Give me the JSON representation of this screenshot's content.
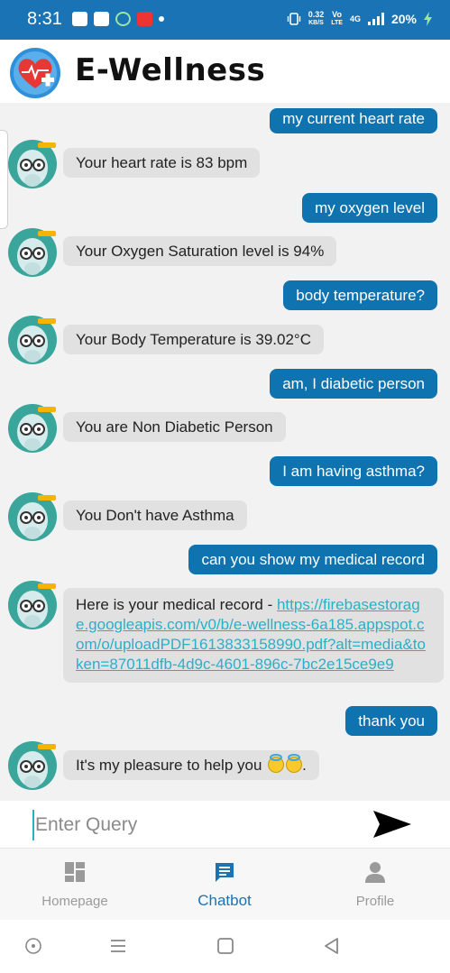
{
  "status_bar": {
    "time": "8:31",
    "net_speed_value": "0.32",
    "net_speed_unit": "KB/S",
    "volte_top": "Vo",
    "volte_bottom": "LTE",
    "network_type": "4G",
    "battery": "20%",
    "colors": {
      "background": "#1a73b4"
    }
  },
  "header": {
    "app_title": "E-Wellness",
    "logo_icon": "heart-plus-logo"
  },
  "chat": {
    "messages": [
      {
        "from": "user",
        "text": "my current heart rate"
      },
      {
        "from": "bot",
        "text": "Your heart rate is 83 bpm"
      },
      {
        "from": "user",
        "text": "my oxygen level"
      },
      {
        "from": "bot",
        "text": "Your Oxygen Saturation level is 94%"
      },
      {
        "from": "user",
        "text": "body temperature?"
      },
      {
        "from": "bot",
        "text": "Your Body Temperature is 39.02°C"
      },
      {
        "from": "user",
        "text": "am, I diabetic person"
      },
      {
        "from": "bot",
        "text": "You are Non Diabetic Person"
      },
      {
        "from": "user",
        "text": "I am having asthma?"
      },
      {
        "from": "bot",
        "text": "You Don't have Asthma"
      },
      {
        "from": "user",
        "text": "can you show my medical record"
      },
      {
        "from": "bot",
        "text": "Here is your medical record - ",
        "link": "https://firebasestorage.googleapis.com/v0/b/e-wellness-6a185.appspot.com/o/uploadPDF1613833158990.pdf?alt=media&token=87011dfb-4d9c-4601-896c-7bc2e15ce9e9"
      },
      {
        "from": "user",
        "text": "thank you"
      },
      {
        "from": "bot",
        "text": "It's my pleasure to help you",
        "suffix": "."
      }
    ],
    "colors": {
      "user_bubble": "#0f73b0",
      "bot_bubble": "#e1e1e1",
      "link": "#27b1c9"
    }
  },
  "input": {
    "placeholder": "Enter Query",
    "value": ""
  },
  "bottom_nav": {
    "items": [
      {
        "label": "Homepage",
        "icon": "dashboard-icon",
        "active": false
      },
      {
        "label": "Chatbot",
        "icon": "chat-icon",
        "active": true
      },
      {
        "label": "Profile",
        "icon": "person-icon",
        "active": false
      }
    ],
    "colors": {
      "active": "#1a73b4",
      "inactive": "#9a9a9a"
    }
  },
  "system_nav": {
    "buttons": [
      "accessibility-icon",
      "recents-icon",
      "home-icon",
      "back-icon"
    ]
  }
}
